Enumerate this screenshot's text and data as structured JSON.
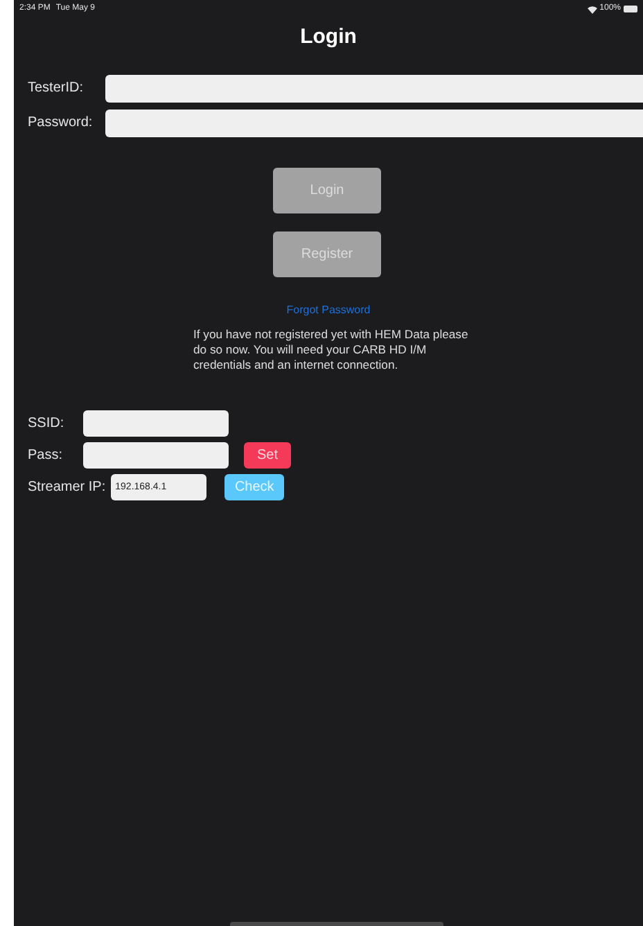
{
  "status_bar": {
    "time": "2:34 PM",
    "date": "Tue May 9",
    "battery": "100%"
  },
  "title": "Login",
  "fields": [
    {
      "label": "TesterID:"
    },
    {
      "label": "Password:"
    }
  ],
  "buttons": [
    {
      "label": "Login"
    },
    {
      "label": "Register"
    }
  ],
  "forgot_link": "Forgot Password",
  "message": "If you have not registered yet with HEM Data please do so now. You will need your CARB HD I/M credentials and an internet connection.",
  "wifi": {
    "ssid_label": "SSID:",
    "pass_label": "Pass:",
    "set_button": "Set",
    "ip_label": "Streamer IP:",
    "ip_value": "192.168.4.1",
    "check_button": "Check"
  }
}
